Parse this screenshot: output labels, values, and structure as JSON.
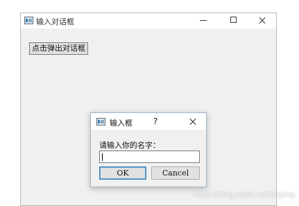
{
  "main_window": {
    "title": "输入对话框",
    "popup_button_label": "点击弹出对话框"
  },
  "dialog": {
    "title": "输入框",
    "help_label": "?",
    "prompt": "请输入你的名字：",
    "input_value": "",
    "ok_label": "OK",
    "cancel_label": "Cancel"
  },
  "watermark": "https://blog.csdn.net/ttuping"
}
